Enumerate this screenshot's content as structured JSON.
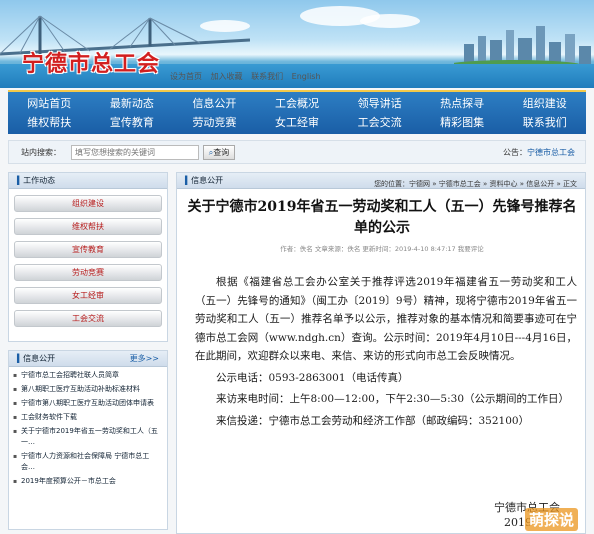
{
  "banner": {
    "site_title": "宁德市总工会",
    "top_links": [
      "设为首页",
      "加入收藏",
      "联系我们",
      "English"
    ]
  },
  "nav": {
    "row1": [
      "网站首页",
      "最新动态",
      "信息公开",
      "工会概况",
      "领导讲话",
      "热点探寻",
      "组织建设"
    ],
    "row2": [
      "维权帮扶",
      "宣传教育",
      "劳动竞赛",
      "女工经审",
      "工会交流",
      "精彩图集",
      "联系我们"
    ]
  },
  "search": {
    "label": "站内搜索：",
    "placeholder": "填写您想搜索的关键词",
    "button": "查询"
  },
  "bulletin": {
    "label": "公告：",
    "text": "宁德市总工会"
  },
  "left": {
    "work_title": "工作动态",
    "work_items": [
      "组织建设",
      "维权帮扶",
      "宣传教育",
      "劳动竞赛",
      "女工经审",
      "工会交流"
    ],
    "info_title": "信息公开",
    "info_more": "更多>>",
    "info_items": [
      "宁德市总工会招聘社联人员简章",
      "第八期职工医疗互助活动补助标准材料",
      "宁德市第八期职工医疗互助活动团体申请表",
      "工会财务软件下载",
      "关于宁德市2019年省五一劳动奖和工人（五一…",
      "宁德市人力资源和社会保障局 宁德市总工会…",
      "2019年度预算公开－市总工会"
    ]
  },
  "article": {
    "section": "信息公开",
    "breadcrumb": "您的位置：宁德网 » 宁德市总工会 » 资料中心 » 信息公开 » 正文",
    "title": "关于宁德市2019年省五一劳动奖和工人（五一）先锋号推荐名单的公示",
    "meta": "作者：佚名  文章来源：佚名  更新时间：2019-4-10 8:47:17  我要评论",
    "paragraphs": [
      "根据《福建省总工会办公室关于推荐评选2019年福建省五一劳动奖和工人（五一）先锋号的通知》（闽工办〔2019〕9号）精神，现将宁德市2019年省五一劳动奖和工人（五一）推荐名单予以公示，推荐对象的基本情况和简要事迹可在宁德市总工会网（www.ndgh.cn）查询。公示时间：2019年4月10日---4月16日，在此期间，欢迎群众以来电、来信、来访的形式向市总工会反映情况。",
      "公示电话：0593-2863001（电话传真）",
      "来访来电时间：上午8:00—12:00，下午2:30—5:30（公示期间的工作日）",
      "来信投递：宁德市总工会劳动和经济工作部（邮政编码：352100）"
    ],
    "sign_org": "宁德市总工会",
    "sign_year": "2019"
  },
  "watermark": "萌探说",
  "colors": {
    "nav_blue": "#1a5ea6",
    "accent_red": "#d21f1f",
    "nav_border_gold": "#f3c94a"
  }
}
